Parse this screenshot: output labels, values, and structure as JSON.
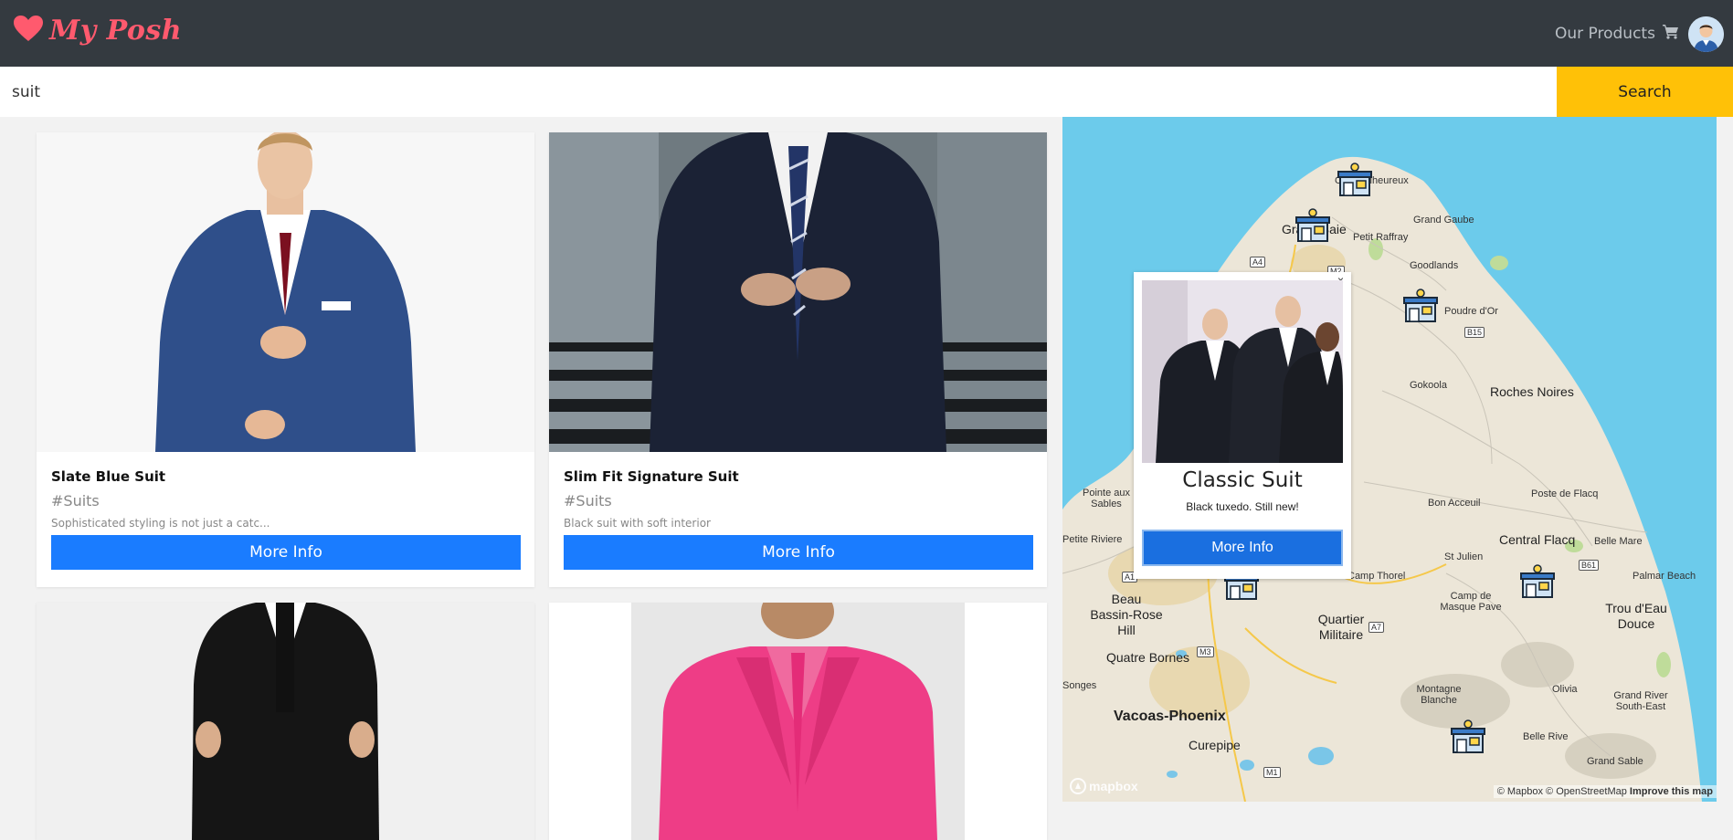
{
  "brand": {
    "name": "My Posh",
    "color": "#ff5a6e"
  },
  "nav": {
    "products_link": "Our Products",
    "cart_icon": "cart-icon",
    "avatar": "user-avatar"
  },
  "search": {
    "value": "suit",
    "button": "Search"
  },
  "products": [
    {
      "title": "Slate Blue Suit",
      "tag": "#Suits",
      "desc": "Sophisticated styling is not just a catc...",
      "button": "More Info"
    },
    {
      "title": "Slim Fit Signature Suit",
      "tag": "#Suits",
      "desc": "Black suit with soft interior",
      "button": "More Info"
    },
    {
      "title": "",
      "tag": "",
      "desc": "",
      "button": ""
    },
    {
      "title": "",
      "tag": "",
      "desc": "",
      "button": ""
    }
  ],
  "map": {
    "labels": [
      "Cap Malheureux",
      "Grand Gaube",
      "Grand Baie",
      "Petit Raffray",
      "Goodlands",
      "Poudre d'Or",
      "Gokoola",
      "Roches Noires",
      "Pointe aux Sables",
      "Bon Acceuil",
      "Poste de Flacq",
      "Petite Riviere",
      "Central Flacq",
      "Belle Mare",
      "St Julien",
      "Camp Thorel",
      "Palmar Beach",
      "Beau Bassin-Rose Hill",
      "Camp de Masque Pave",
      "Trou d'Eau Douce",
      "Quartier Militaire",
      "Quatre Bornes",
      "Vacoas-Phoenix",
      "Montagne Blanche",
      "Olivia",
      "Grand River South-East",
      "Curepipe",
      "Belle Rive",
      "Grand Sable",
      "Songes"
    ],
    "roads": [
      "A4",
      "M2",
      "B15",
      "A1",
      "A7",
      "B61",
      "M3",
      "M1"
    ],
    "popup": {
      "title": "Classic Suit",
      "desc": "Black tuxedo. Still new!",
      "button": "More Info",
      "close": "×"
    },
    "logo": "mapbox",
    "attribution": "© Mapbox © OpenStreetMap",
    "improve": "Improve this map"
  }
}
